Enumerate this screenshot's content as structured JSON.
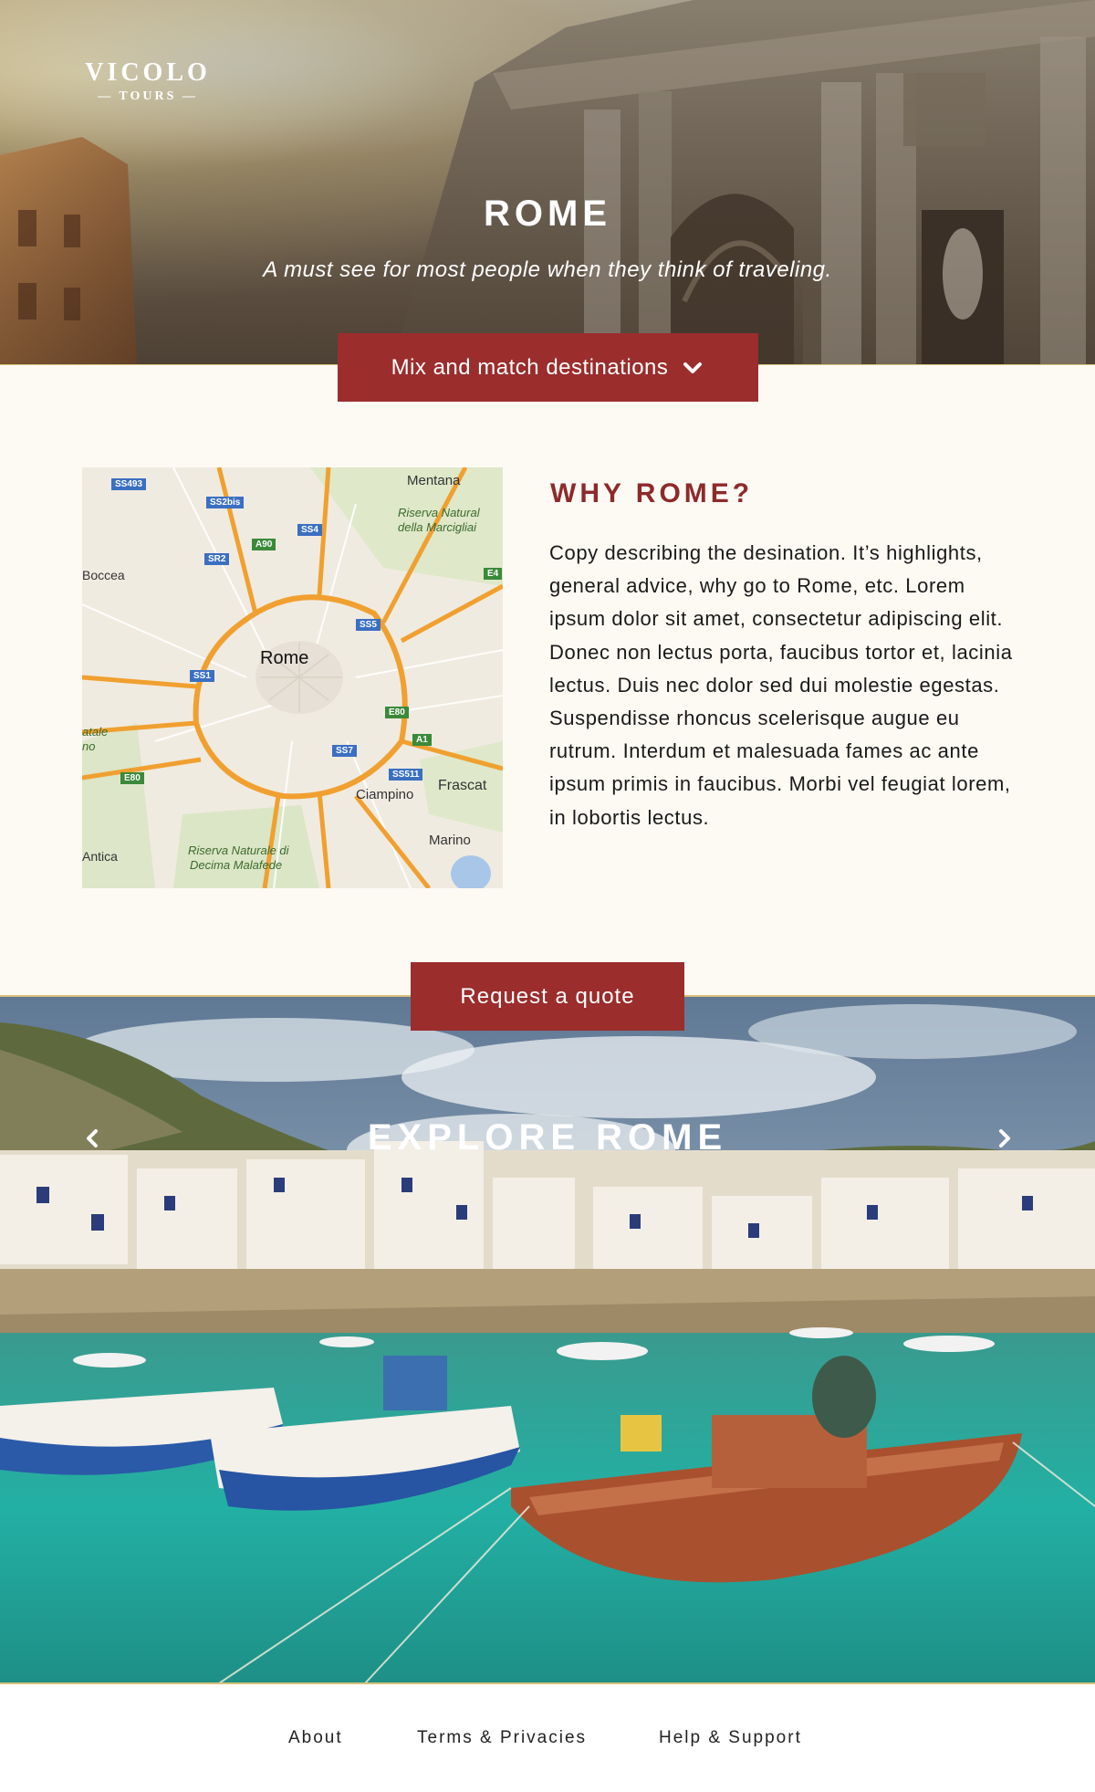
{
  "logo": {
    "name": "VICOLO",
    "sub": "— TOURS —"
  },
  "hero": {
    "title": "ROME",
    "tagline": "A must see for most people when they think of traveling.",
    "mix_button_label": "Mix and match destinations"
  },
  "map": {
    "labels": {
      "mentana": "Mentana",
      "riserva_north": "Riserva Natural",
      "riserva_north_2": "della Marcigliai",
      "boccea": "Boccea",
      "rome": "Rome",
      "atale": "atale",
      "no": "no",
      "antica": "Antica",
      "riserva_south": "Riserva Naturale di",
      "riserva_south_2": "Decima Malafede",
      "frascati": "Frascat",
      "ciampino": "Ciampino",
      "marino": "Marino"
    },
    "shields": [
      "SS493",
      "SS2bis",
      "SS4",
      "A90",
      "SR2",
      "E4",
      "SS5",
      "SS1",
      "E80",
      "A1",
      "SS7",
      "SS511",
      "E80"
    ]
  },
  "why": {
    "title": "WHY ROME?",
    "body": "Copy describing the desination. It’s highlights, general advice, why go to Rome, etc. Lorem ipsum dolor sit amet, consectetur adipiscing elit. Donec non lectus porta, faucibus tortor et, lacinia lectus. Duis nec dolor sed dui molestie egestas. Suspendisse rhoncus scelerisque augue eu rutrum. Interdum et malesuada fames ac ante ipsum primis in faucibus. Morbi vel feugiat lorem, in lobortis lectus."
  },
  "quote_button_label": "Request a quote",
  "explore": {
    "title": "EXPLORE ROME"
  },
  "footer": {
    "about": "About",
    "terms": "Terms & Privacies",
    "help": "Help & Support"
  },
  "colors": {
    "accent": "#9b2d2d",
    "accent_text": "#8e2a2a",
    "cream": "#fdfaf4",
    "gold_rule": "#d8c27a"
  },
  "icons": [
    "chevron-down-icon",
    "chevron-left-icon",
    "chevron-right-icon"
  ]
}
